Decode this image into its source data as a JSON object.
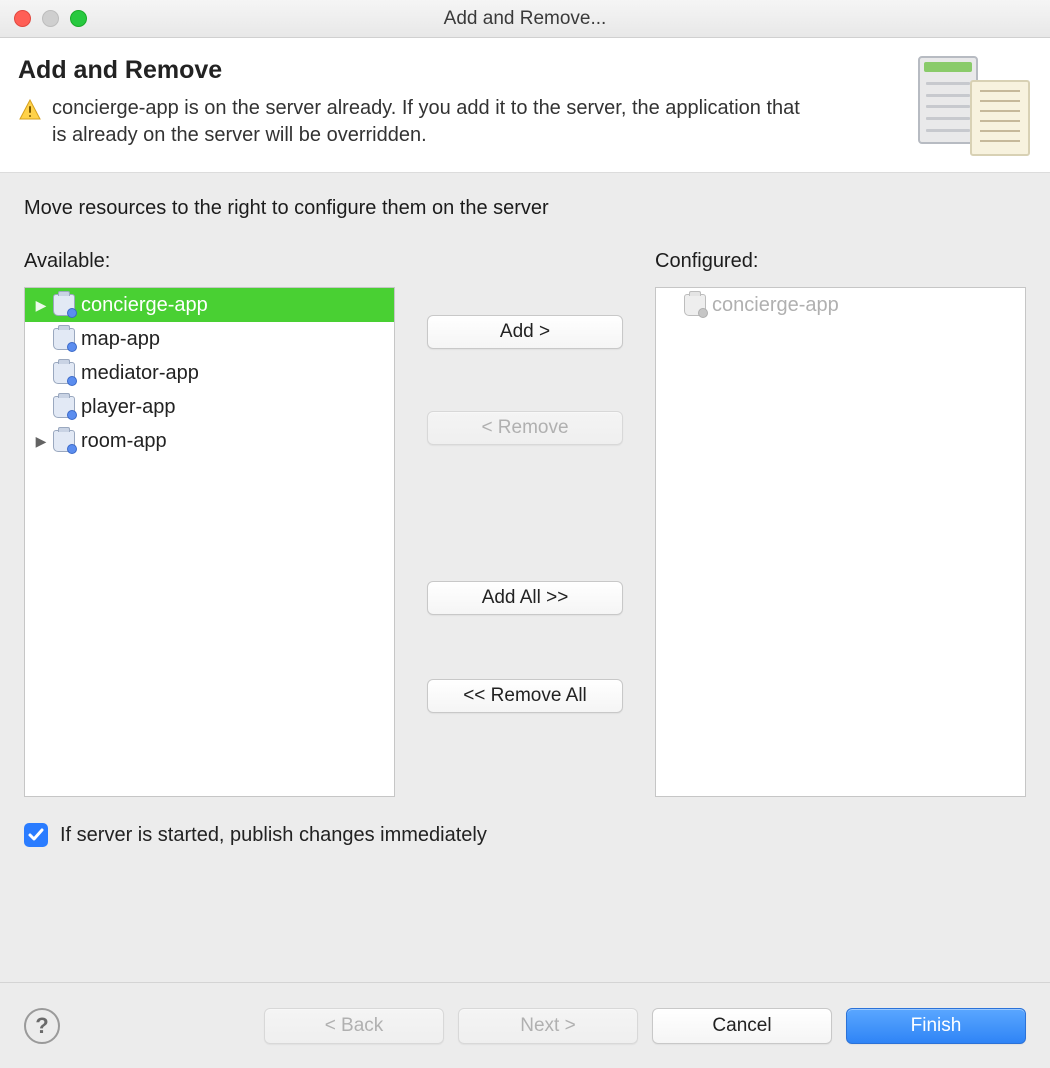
{
  "window": {
    "title": "Add and Remove..."
  },
  "header": {
    "title": "Add and Remove",
    "message": " concierge-app is on the server already. If you add it to the server, the application that is already on the server will be overridden."
  },
  "body": {
    "instruction": "Move resources to the right to configure them on the server",
    "available_label": "Available:",
    "configured_label": "Configured:",
    "available": [
      {
        "name": "concierge-app",
        "expandable": true,
        "selected": true
      },
      {
        "name": "map-app",
        "expandable": false,
        "selected": false
      },
      {
        "name": "mediator-app",
        "expandable": false,
        "selected": false
      },
      {
        "name": "player-app",
        "expandable": false,
        "selected": false
      },
      {
        "name": "room-app",
        "expandable": true,
        "selected": false
      }
    ],
    "configured": [
      {
        "name": "concierge-app",
        "disabled": true
      }
    ],
    "buttons": {
      "add": "Add >",
      "remove": "< Remove",
      "add_all": "Add All >>",
      "remove_all": "<< Remove All"
    },
    "checkbox": {
      "checked": true,
      "label": "If server is started, publish changes immediately"
    }
  },
  "footer": {
    "back": "< Back",
    "next": "Next >",
    "cancel": "Cancel",
    "finish": "Finish"
  }
}
